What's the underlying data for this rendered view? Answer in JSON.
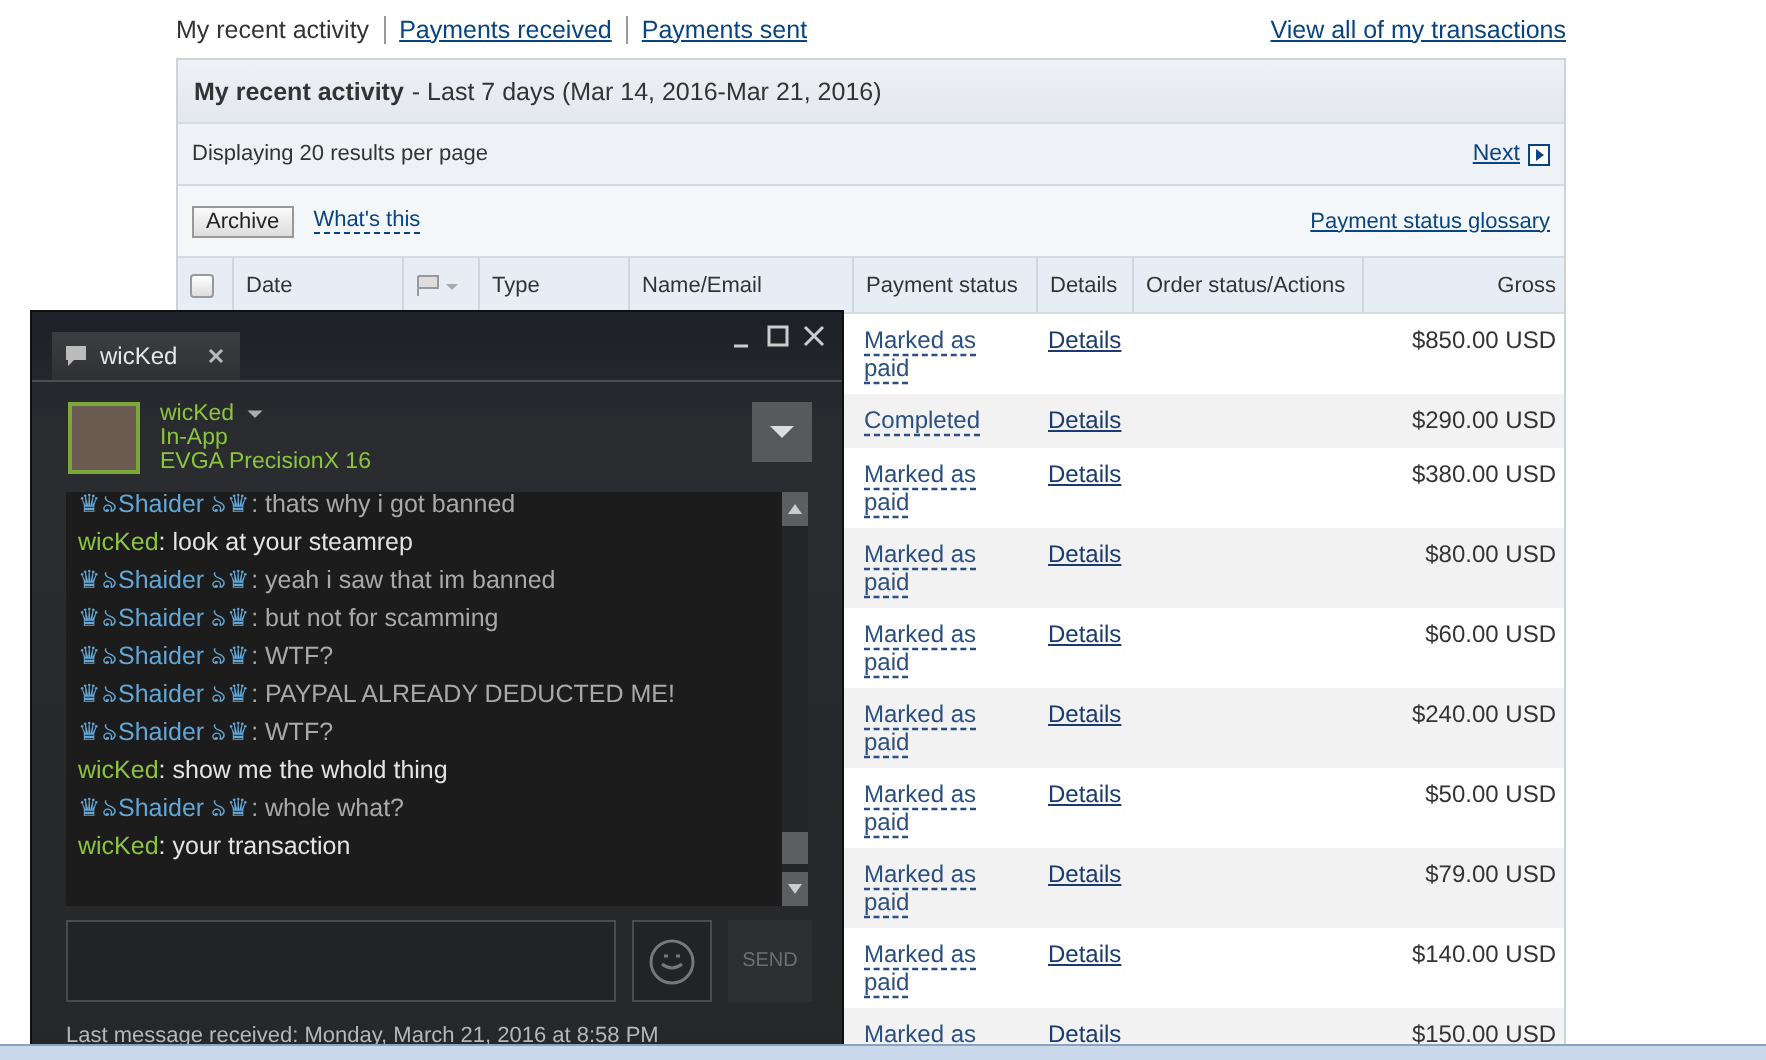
{
  "nav": {
    "tabs": [
      {
        "label": "My recent activity",
        "selected": true
      },
      {
        "label": "Payments received",
        "selected": false
      },
      {
        "label": "Payments sent",
        "selected": false
      }
    ],
    "all_link": "View all of my transactions"
  },
  "panel": {
    "title": "My recent activity",
    "subtitle": "- Last 7 days (Mar 14, 2016-Mar 21, 2016)",
    "per_page": "Displaying 20 results per page",
    "next": "Next",
    "archive": "Archive",
    "whats_this": "What's this",
    "glossary": "Payment status glossary"
  },
  "table": {
    "select_all": {
      "checked": false
    },
    "columns": [
      "Date",
      "Type",
      "Name/Email",
      "Payment status",
      "Details",
      "Order status/Actions",
      "Gross"
    ],
    "rows": [
      {
        "payment_status": "Marked as paid",
        "details": "Details",
        "gross": "$850.00 USD"
      },
      {
        "payment_status": "Completed",
        "details": "Details",
        "gross": "$290.00 USD"
      },
      {
        "payment_status": "Marked as paid",
        "details": "Details",
        "gross": "$380.00 USD"
      },
      {
        "payment_status": "Marked as paid",
        "details": "Details",
        "gross": "$80.00 USD"
      },
      {
        "payment_status": "Marked as paid",
        "details": "Details",
        "gross": "$60.00 USD"
      },
      {
        "payment_status": "Marked as paid",
        "details": "Details",
        "gross": "$240.00 USD"
      },
      {
        "payment_status": "Marked as paid",
        "details": "Details",
        "gross": "$50.00 USD"
      },
      {
        "payment_status": "Marked as paid",
        "details": "Details",
        "gross": "$79.00 USD"
      },
      {
        "payment_status": "Marked as paid",
        "details": "Details",
        "gross": "$140.00 USD"
      },
      {
        "payment_status": "Marked as",
        "details": "Details",
        "gross": "$150.00 USD"
      }
    ]
  },
  "chat": {
    "tab": "wicKed",
    "contact": {
      "name": "wicKed",
      "status": "In-App",
      "game": "EVGA PrecisionX 16"
    },
    "messages": [
      {
        "kind": "them",
        "sender": "♛ঌShaider ঌ♛",
        "text": ": thats why i got banned"
      },
      {
        "kind": "me",
        "sender": "wicKed",
        "text": ": look at your steamrep"
      },
      {
        "kind": "them",
        "sender": "♛ঌShaider ঌ♛",
        "text": ": yeah i saw that im banned"
      },
      {
        "kind": "them",
        "sender": "♛ঌShaider ঌ♛",
        "text": ": but not for scamming"
      },
      {
        "kind": "them",
        "sender": "♛ঌShaider ঌ♛",
        "text": ": WTF?"
      },
      {
        "kind": "them",
        "sender": "♛ঌShaider ঌ♛",
        "text": ": PAYPAL ALREADY DEDUCTED ME!"
      },
      {
        "kind": "them",
        "sender": "♛ঌShaider ঌ♛",
        "text": ": WTF?"
      },
      {
        "kind": "me",
        "sender": "wicKed",
        "text": ": show me the whold thing"
      },
      {
        "kind": "them",
        "sender": "♛ঌShaider ঌ♛",
        "text": ": whole what?"
      },
      {
        "kind": "me",
        "sender": "wicKed",
        "text": ": your transaction"
      }
    ],
    "send": "SEND",
    "footer": "Last message received: Monday, March 21, 2016 at 8:58 PM"
  }
}
